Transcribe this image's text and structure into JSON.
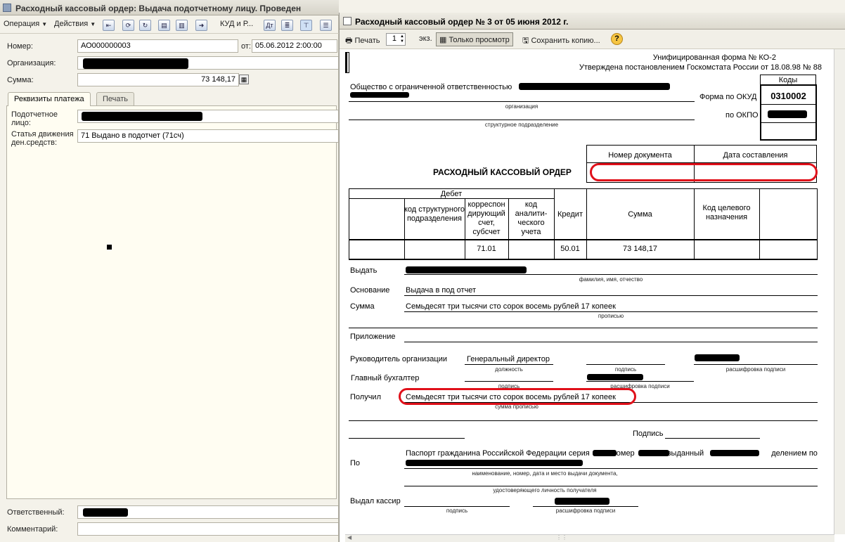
{
  "left_window": {
    "title": "Расходный кассовый ордер: Выдача подотчетному лицу. Проведен",
    "toolbar": {
      "operation": "Операция",
      "actions": "Действия",
      "kud_label": "КУД и Р..."
    },
    "number_label": "Номер:",
    "number_value": "АО000000003",
    "from_label": "от:",
    "date_value": "05.06.2012  2:00:00",
    "org_label": "Организация:",
    "sum_label": "Сумма:",
    "sum_value": "73 148,17",
    "tabs": [
      "Реквизиты платежа",
      "Печать"
    ],
    "person_label": "Подотчетное лицо:",
    "movement_label": "Статья движения ден.средств:",
    "movement_value": "71 Выдано в подотчет (71сч)",
    "responsible_label": "Ответственный:",
    "responsible_value": "И.Р.",
    "comment_label": "Комментарий:"
  },
  "right_window": {
    "title": "Расходный кассовый ордер № 3 от 05 июня 2012 г.",
    "toolbar": {
      "print": "Печать",
      "copies": "1",
      "copies_unit": "экз.",
      "view_only": "Только просмотр",
      "save_copy": "Сохранить копию..."
    },
    "document": {
      "unified_form": "Унифицированная форма № КО-2",
      "approved": "Утверждена постановлением Госкомстата России от 18.08.98 № 88",
      "codes_header": "Коды",
      "okud_label": "Форма по ОКУД",
      "okud_code": "0310002",
      "okpo_label": "по ОКПО",
      "org_name": "Общество с ограниченной ответственностью",
      "org_caption": "организация",
      "struct_caption": "структурное подразделение",
      "doc_number_header": "Номер документа",
      "doc_date_header": "Дата составления",
      "heading": "РАСХОДНЫЙ КАССОВЫЙ ОРДЕР",
      "debit_header": "Дебет",
      "col_struct_code": "код структурного подразделения",
      "col_corr_account": "корреспон дирующий счет, субсчет",
      "col_analytic_code": "код аналити-ческого учета",
      "col_credit": "Кредит",
      "col_sum": "Сумма",
      "col_target_code": "Код целевого назначения",
      "row_corr_account": "71.01",
      "row_credit": "50.01",
      "row_sum": "73 148,17",
      "issue_label": "Выдать",
      "fio_caption": "фамилия, имя, отчество",
      "basis_label": "Основание",
      "basis_value": "Выдача в под отчет",
      "sum_label": "Сумма",
      "sum_words": "Семьдесят три тысячи сто сорок восемь рублей 17 копеек",
      "in_words_caption": "прописью",
      "attachment_label": "Приложение",
      "head_label": "Руководитель организации",
      "head_position": "Генеральный директор",
      "position_caption": "должность",
      "signature_caption": "подпись",
      "decode_caption": "расшифровка подписи",
      "accountant_label": "Главный бухгалтер",
      "received_label": "Получил",
      "received_words": "Семьдесят три тысячи сто сорок восемь рублей 17 копеек",
      "sum_in_words_caption": "сумма прописью",
      "signature_label": "Подпись",
      "by_label": "По",
      "passport_prefix": "Паспорт гражданина Российской Федерации серия",
      "passport_number": "номер",
      "passport_issued": "выданный",
      "passport_dept": "делением по",
      "passport_caption": "наименование, номер, дата и место выдачи документа,",
      "identity_caption": "удостоверяющего личность получателя",
      "cashier_label": "Выдал кассир"
    }
  }
}
